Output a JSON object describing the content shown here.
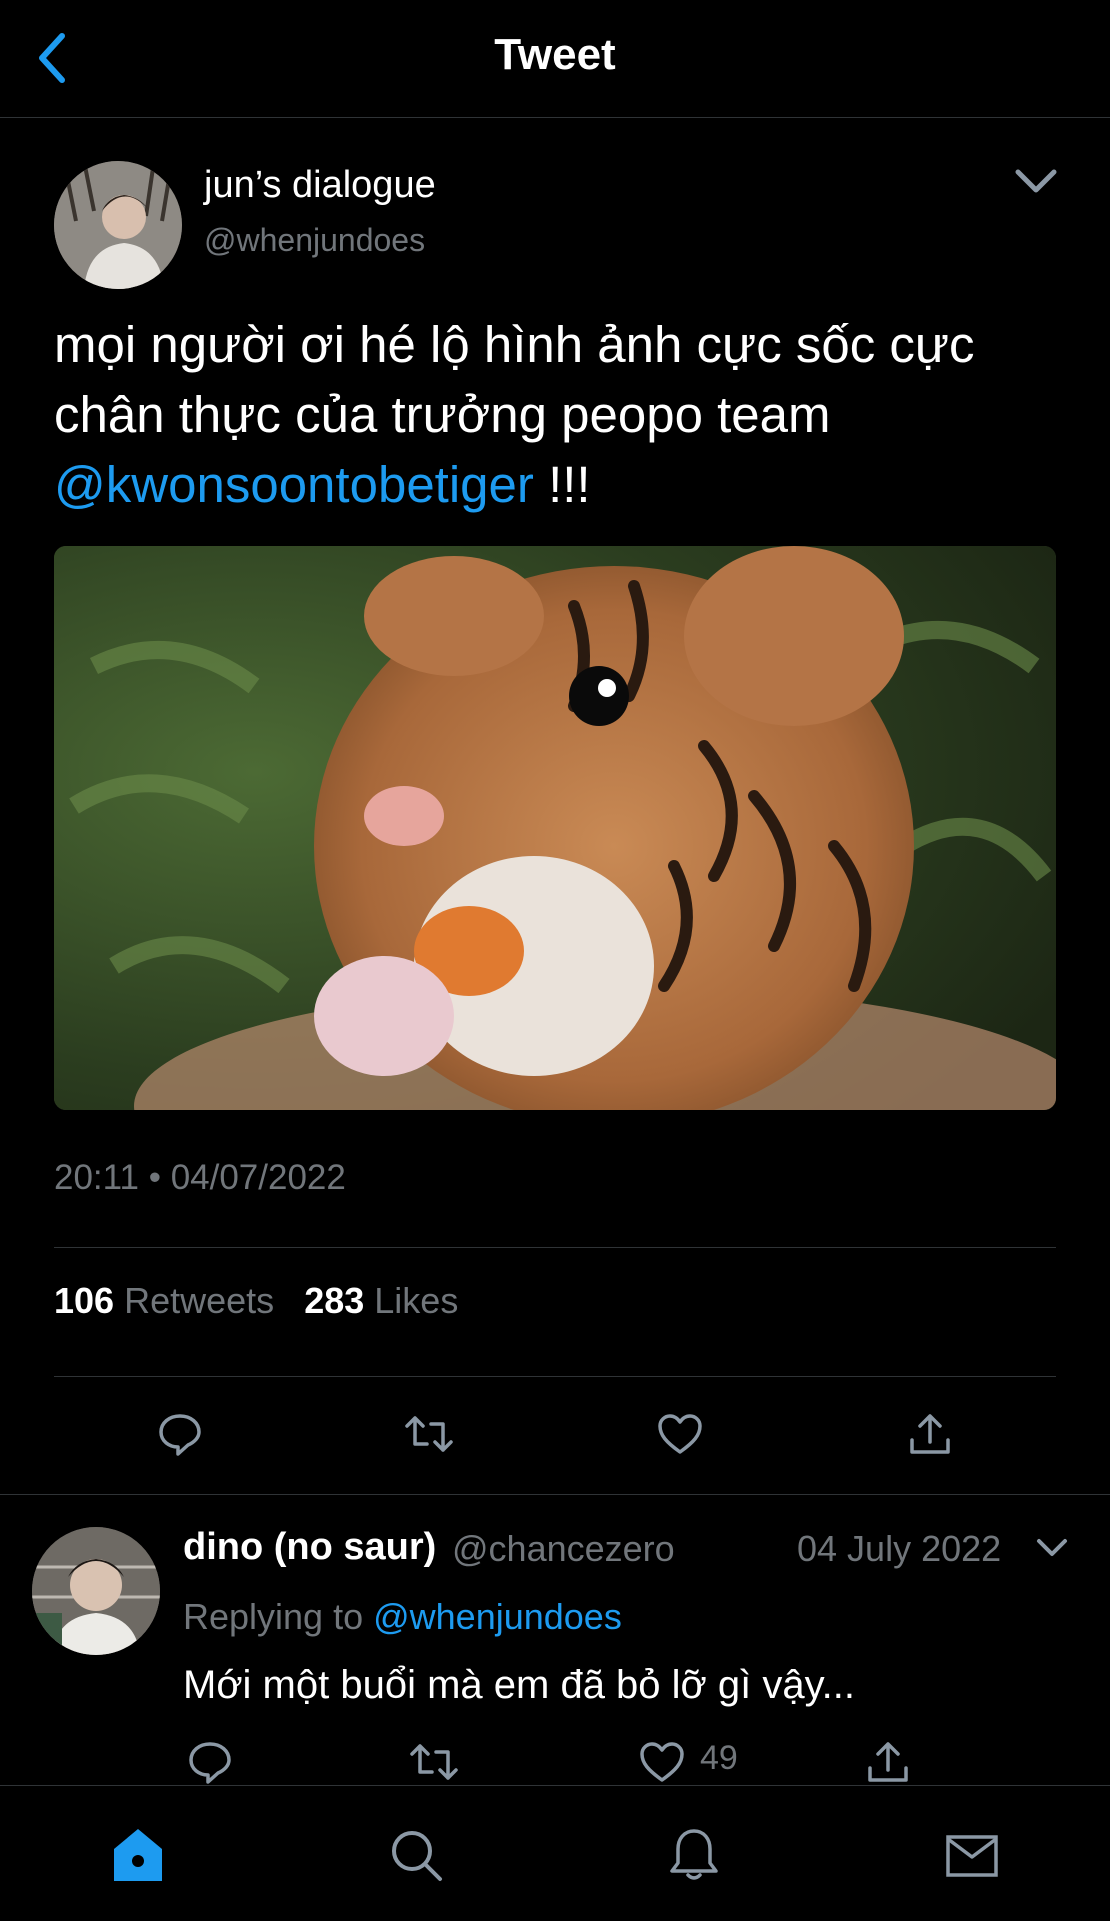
{
  "header": {
    "title": "Tweet"
  },
  "tweet": {
    "author_name": "jun’s dialogue",
    "author_handle": "@whenjundoes",
    "text_before": "mọi người ơi hé lộ hình ảnh cực sốc cực chân thực của trưởng peopo team ",
    "mention": "@kwonsoontobetiger",
    "text_after": " !!!",
    "timestamp": "20:11 • 04/07/2022",
    "retweet_count": "106",
    "retweet_label": "Retweets",
    "like_count": "283",
    "like_label": "Likes"
  },
  "reply": {
    "author_name": "dino (no saur)",
    "author_handle": "@chancezero",
    "date": "04 July 2022",
    "replying_prefix": "Replying to ",
    "replying_handle": "@whenjundoes",
    "text": "Mới một buổi mà em đã bỏ lỡ gì vậy...",
    "like_count": "49"
  },
  "colors": {
    "accent": "#1d9bf0",
    "background": "#000000",
    "muted": "#71767b"
  },
  "icons": [
    "chevron-left-icon",
    "chevron-down-icon",
    "reply-icon",
    "retweet-icon",
    "like-icon",
    "share-icon",
    "home-icon",
    "search-icon",
    "notifications-icon",
    "messages-icon"
  ]
}
